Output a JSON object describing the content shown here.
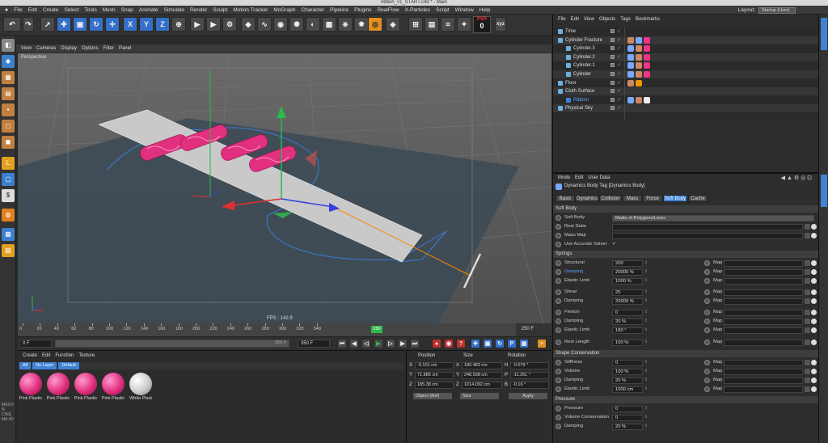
{
  "window": {
    "title": "ribbon_v1_START.c4d * - Main"
  },
  "menu": [
    "File",
    "Edit",
    "Create",
    "Select",
    "Tools",
    "Mesh",
    "Snap",
    "Animate",
    "Simulate",
    "Render",
    "Sculpt",
    "Motion Tracker",
    "MoGraph",
    "Character",
    "Pipeline",
    "Plugins",
    "RealFlow",
    "X-Particles",
    "Script",
    "Window",
    "Help"
  ],
  "layout": {
    "label": "Layout:",
    "value": "Startup (User)"
  },
  "toolbar": {
    "x": "X",
    "y": "Y",
    "z": "Z",
    "psr_label": "PSR",
    "psr_value": "0"
  },
  "viewport": {
    "menu": [
      "View",
      "Cameras",
      "Display",
      "Options",
      "Filter",
      "Panel"
    ],
    "label": "Perspective",
    "fps": "FPS : 142.9",
    "accent_selection": "#ff8a00"
  },
  "timeline": {
    "ticks": [
      "0",
      "20",
      "40",
      "60",
      "80",
      "100",
      "120",
      "140",
      "160",
      "180",
      "200",
      "220",
      "240",
      "260",
      "280",
      "300",
      "320",
      "340"
    ],
    "current": "250",
    "end_label": "250 F"
  },
  "transport": {
    "start": "0 F",
    "cur_field": "0 F",
    "max_field": "350 F",
    "end_field": "350 F"
  },
  "materials": {
    "menu": [
      "Create",
      "Edit",
      "Function",
      "Texture"
    ],
    "filters": [
      "All",
      "No Layer",
      "Default"
    ],
    "items": [
      {
        "name": "Pink Plastic",
        "type": "pink"
      },
      {
        "name": "Pink Plastic",
        "type": "pink"
      },
      {
        "name": "Pink Plastic",
        "type": "pink"
      },
      {
        "name": "Pink Plastic",
        "type": "pink"
      },
      {
        "name": "White Plast",
        "type": "white"
      }
    ],
    "logo": "MAXON CINEMA 4D"
  },
  "coords": {
    "headers": [
      "Position",
      "Size",
      "Rotation"
    ],
    "rows": [
      {
        "axis": "X",
        "pos": "-0.101 cm",
        "saxis": "X",
        "size": "180.483 cm",
        "raxis": "H",
        "rot": "-0.079 °"
      },
      {
        "axis": "Y",
        "pos": "71.885 cm",
        "saxis": "Y",
        "size": "248.598 cm",
        "raxis": "P",
        "rot": "-11.261 °"
      },
      {
        "axis": "Z",
        "pos": "185.38 cm",
        "saxis": "Z",
        "size": "1014.092 cm",
        "raxis": "B",
        "rot": "-0.16 °"
      }
    ],
    "mode": "Object (Rel)",
    "size_mode": "Size",
    "apply": "Apply"
  },
  "objects": {
    "menu": [
      "File",
      "Edit",
      "View",
      "Objects",
      "Tags",
      "Bookmarks"
    ],
    "rows": [
      {
        "name": "Time",
        "indent": 0,
        "tags": []
      },
      {
        "name": "Cylinder Fracture",
        "indent": 0,
        "tags": [
          "#c86",
          "#7af",
          "#e38"
        ]
      },
      {
        "name": "Cylinder.3",
        "indent": 1,
        "tags": [
          "#7af",
          "#c86",
          "#e38"
        ]
      },
      {
        "name": "Cylinder.2",
        "indent": 1,
        "tags": [
          "#7af",
          "#c86",
          "#e38"
        ]
      },
      {
        "name": "Cylinder.1",
        "indent": 1,
        "tags": [
          "#7af",
          "#c86",
          "#e38"
        ]
      },
      {
        "name": "Cylinder",
        "indent": 1,
        "tags": [
          "#7af",
          "#c86",
          "#e38"
        ]
      },
      {
        "name": "Floor",
        "indent": 0,
        "tags": [
          "#c86",
          "#e90"
        ]
      },
      {
        "name": "Cloth Surface",
        "indent": 0,
        "tags": []
      },
      {
        "name": "Ribbon",
        "indent": 1,
        "tags": [
          "#7af",
          "#c86",
          "#eee"
        ],
        "selected": true
      },
      {
        "name": "Physical Sky",
        "indent": 0,
        "tags": []
      }
    ]
  },
  "attributes": {
    "menu": [
      "Mode",
      "Edit",
      "User Data"
    ],
    "title": "Dynamics Body Tag [Dynamics Body]",
    "tabs": [
      "Basic",
      "Dynamics",
      "Collision",
      "Mass",
      "Force",
      "Soft Body",
      "Cache"
    ],
    "active_tab": "Soft Body",
    "sections": {
      "softbody": "Soft Body",
      "springs": "Springs",
      "shape": "Shape Conservation",
      "pressure": "Pressure"
    },
    "soft_body": {
      "label": "Soft Body",
      "value": "Made of Polygons/Lines"
    },
    "rest_state": "Rest State",
    "mass_map": "Mass Map",
    "accurate": "Use Accurate Solver",
    "map_label": "Map",
    "springs": [
      {
        "label": "Structural",
        "value": "200"
      },
      {
        "label": "Damping",
        "value": "20000 %",
        "hl": true
      },
      {
        "label": "Elastic Limit",
        "value": "1000 %"
      },
      {
        "label": "Shear",
        "value": "25"
      },
      {
        "label": "Damping",
        "value": "20000 %"
      },
      {
        "label": "Flexion",
        "value": "0"
      },
      {
        "label": "Damping",
        "value": "20 %"
      },
      {
        "label": "Elastic Limit",
        "value": "180 °"
      },
      {
        "label": "Rest Length",
        "value": "100 %"
      }
    ],
    "shape_rows": [
      {
        "label": "Stiffness",
        "value": "0"
      },
      {
        "label": "Volume",
        "value": "100 %"
      },
      {
        "label": "Damping",
        "value": "20 %"
      },
      {
        "label": "Elastic Limit",
        "value": "1000 cm"
      }
    ],
    "pressure_rows": [
      {
        "label": "Pressure",
        "value": "0"
      },
      {
        "label": "Volume Conservation",
        "value": "0"
      },
      {
        "label": "Damping",
        "value": "20 %"
      }
    ]
  }
}
